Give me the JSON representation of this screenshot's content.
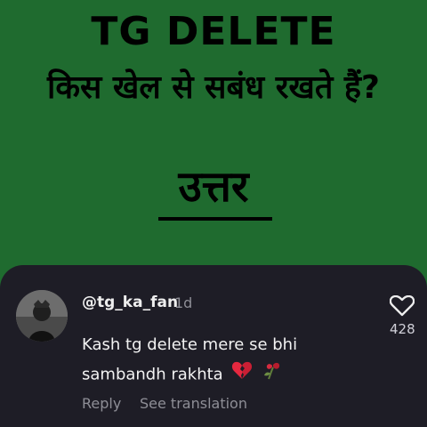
{
  "header": {
    "title_en": "TG DELETE",
    "title_hi": "किस खेल से सबंध रखते हैं?",
    "answer": "उत्तर"
  },
  "comment": {
    "username": "@tg_ka_fan",
    "age": "1d",
    "text": "Kash tg delete mere se bhi sambandh rakhta",
    "emojis": "💔🥀",
    "reply_label": "Reply",
    "translation_label": "See translation",
    "like_count": "428",
    "icons": {
      "heart": "heart-icon",
      "broken_heart": "broken-heart-icon",
      "wilted_rose": "wilted-rose-icon"
    }
  },
  "colors": {
    "background": "#1f6b2f",
    "card": "#1e1d26",
    "text": "#f2f2f2",
    "muted": "#8e8e96"
  }
}
